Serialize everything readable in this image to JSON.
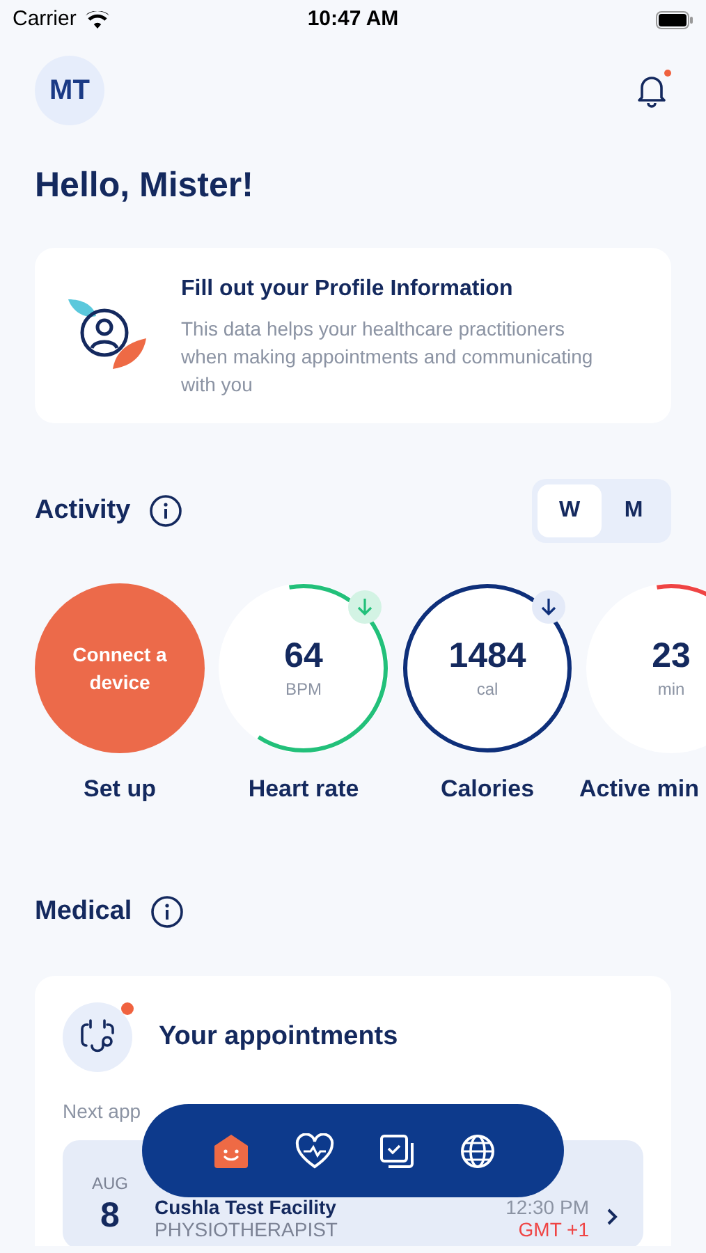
{
  "status_bar": {
    "carrier": "Carrier",
    "time": "10:47 AM"
  },
  "header": {
    "avatar_initials": "MT",
    "notification_unread": true
  },
  "greeting": "Hello, Mister!",
  "profile_card": {
    "title": "Fill out your Profile Information",
    "body": "This data helps your healthcare practitioners when making appointments and communicating with you"
  },
  "activity": {
    "title": "Activity",
    "period_tabs": [
      {
        "label": "W",
        "selected": true
      },
      {
        "label": "M",
        "selected": false
      }
    ],
    "metrics": [
      {
        "kind": "action",
        "text": "Connect a device",
        "label": "Set up"
      },
      {
        "kind": "ring",
        "value": "64",
        "unit": "BPM",
        "label": "Heart rate",
        "color": "#22c07a",
        "trend_down": true
      },
      {
        "kind": "ring",
        "value": "1484",
        "unit": "cal",
        "label": "Calories",
        "color": "#0e2f7a",
        "trend_down": true
      },
      {
        "kind": "ring",
        "value": "23",
        "unit": "min",
        "label": "Active min",
        "color": "#ef4444",
        "trend_down": false
      }
    ]
  },
  "medical": {
    "title": "Medical",
    "appointments": {
      "title": "Your appointments",
      "unread": true,
      "subtitle": "Next app",
      "next": {
        "month": "AUG",
        "day": "8",
        "facility": "Cushla Test Facility",
        "specialty": "PHYSIOTHERAPIST",
        "time": "12:30 PM",
        "timezone": "GMT +1"
      }
    }
  },
  "nav": [
    {
      "kind": "home",
      "selected": true
    },
    {
      "kind": "health",
      "selected": false
    },
    {
      "kind": "tasks",
      "selected": false
    },
    {
      "kind": "web",
      "selected": false
    }
  ]
}
